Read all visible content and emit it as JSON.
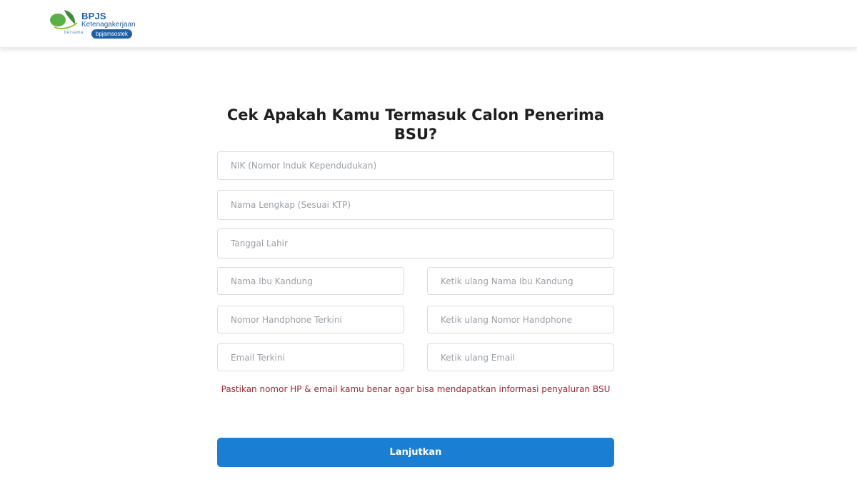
{
  "header": {
    "logo": {
      "title": "BPJS",
      "subtitle": "Ketenagakerjaan",
      "tag_prefix": "bersama",
      "tag": "bpjamsostek"
    }
  },
  "form": {
    "title": "Cek Apakah Kamu Termasuk Calon Penerima BSU?",
    "fields": {
      "nik": {
        "placeholder": "NIK (Nomor Induk Kependudukan)",
        "value": ""
      },
      "nama_lengkap": {
        "placeholder": "Nama Lengkap (Sesuai KTP)",
        "value": ""
      },
      "tanggal_lahir": {
        "placeholder": "Tanggal Lahir",
        "value": ""
      },
      "nama_ibu": {
        "placeholder": "Nama Ibu Kandung",
        "value": ""
      },
      "nama_ibu_ulang": {
        "placeholder": "Ketik ulang Nama Ibu Kandung",
        "value": ""
      },
      "nomor_hp": {
        "placeholder": "Nomor Handphone Terkini",
        "value": ""
      },
      "nomor_hp_ulang": {
        "placeholder": "Ketik ulang Nomor Handphone",
        "value": ""
      },
      "email": {
        "placeholder": "Email Terkini",
        "value": ""
      },
      "email_ulang": {
        "placeholder": "Ketik ulang Email",
        "value": ""
      }
    },
    "notice": "Pastikan nomor HP & email kamu benar agar bisa mendapatkan informasi penyaluran BSU",
    "submit_label": "Lanjutkan"
  },
  "colors": {
    "brand_blue": "#1f5fa8",
    "brand_green": "#5ab046",
    "button": "#1a7fd3",
    "notice": "#a02634"
  }
}
